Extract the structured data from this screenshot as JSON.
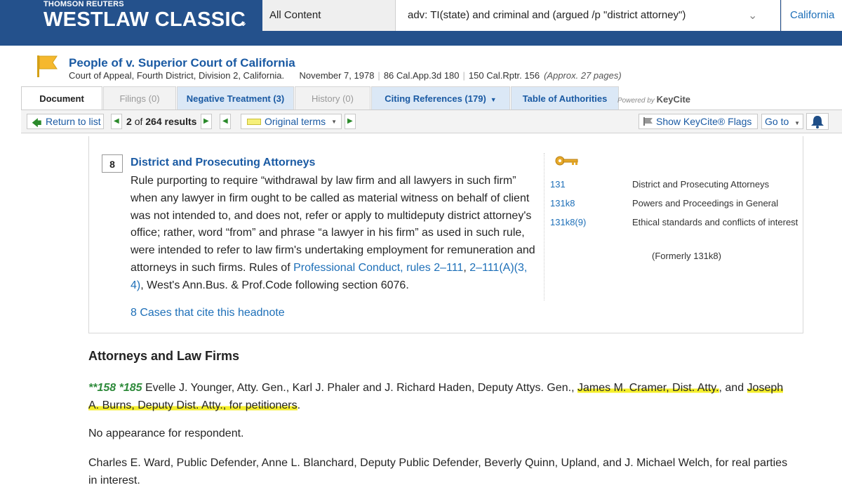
{
  "header": {
    "brand_top": "THOMSON REUTERS",
    "brand_main": "WESTLAW CLASSIC",
    "search_scope": "All Content",
    "search_query": "adv: TI(state) and criminal and (argued /p \"district attorney\")",
    "jurisdiction": "California"
  },
  "document": {
    "title": "People of v. Superior Court of California",
    "court": "Court of Appeal, Fourth District, Division 2, California.",
    "date": "November 7, 1978",
    "cite1": "86 Cal.App.3d 180",
    "cite2": "150 Cal.Rptr. 156",
    "pages": "(Approx. 27 pages)"
  },
  "tabs": [
    {
      "label": "Document"
    },
    {
      "label": "Filings (0)"
    },
    {
      "label": "Negative Treatment (3)"
    },
    {
      "label": "History (0)"
    },
    {
      "label": "Citing References (179)"
    },
    {
      "label": "Table of Authorities"
    }
  ],
  "powered_by": {
    "text": "Powered by",
    "brand": "KeyCite"
  },
  "toolbar": {
    "return_label": "Return to list",
    "result_current": "2",
    "result_of": "of",
    "result_total": "264 results",
    "terms_label": "Original terms",
    "keycite_label": "Show KeyCite® Flags",
    "goto_label": "Go to"
  },
  "headnote": {
    "number": "8",
    "title": "District and Prosecuting Attorneys",
    "body_1": "Rule purporting to require “withdrawal by law firm and all lawyers in such firm” when any lawyer in firm ought to be called as material witness on behalf of client was not intended to, and does not, refer or apply to multideputy district attorney's office; rather, word “from” and phrase “a lawyer in his firm” as used in such rule, were intended to refer to law firm's undertaking employment for remuneration and attorneys in such firms. Rules of ",
    "link_1": "Professional Conduct, rules 2–111",
    "comma": ", ",
    "link_2": "2–111(A)(3, 4)",
    "body_2": ", West's Ann.Bus. & Prof.Code following section 6076.",
    "cases_link": "8 Cases that cite this headnote",
    "key_numbers": [
      {
        "code": "131",
        "desc": "District and Prosecuting Attorneys"
      },
      {
        "code": "131k8",
        "desc": "Powers and Proceedings in General"
      },
      {
        "code": "131k8(9)",
        "desc": "Ethical standards and conflicts of interest"
      }
    ],
    "formerly": "(Formerly 131k8)"
  },
  "section": {
    "title": "Attorneys and Law Firms",
    "star_pages": "**158 *185",
    "para1_plain": " Evelle J. Younger, Atty. Gen., Karl J. Phaler and J. Richard Haden, Deputy Attys. Gen., ",
    "para1_hl1": "James M. Cramer, Dist. Atty.",
    "para1_mid": ", and ",
    "para1_hl2": "Joseph A. Burns, Deputy Dist. Atty., for petitioners",
    "para1_end": ".",
    "para2": "No appearance for respondent.",
    "para3": "Charles E. Ward, Public Defender, Anne L. Blanchard, Deputy Public Defender, Beverly Quinn, Upland, and J. Michael Welch, for real parties in interest."
  },
  "colors": {
    "header_bg": "#24518c",
    "link": "#1d6fb8",
    "highlight": "#f5ef2a",
    "star_page": "#2d8a3a"
  }
}
